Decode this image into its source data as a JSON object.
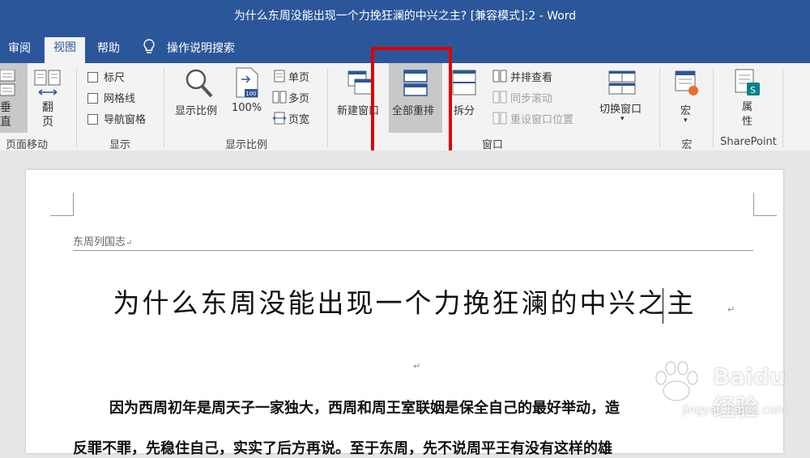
{
  "window": {
    "title": "为什么东周没能出现一个力挽狂澜的中兴之主?  [兼容模式]:2  -  Word"
  },
  "tabs": [
    {
      "label": "审阅"
    },
    {
      "label": "视图"
    },
    {
      "label": "帮助"
    },
    {
      "label": "操作说明搜索"
    }
  ],
  "ribbon": {
    "page_movement": {
      "vertical": "垂\n直",
      "flip": "翻\n页",
      "group": "页面移动"
    },
    "show": {
      "ruler": "标尺",
      "gridlines": "网格线",
      "nav_pane": "导航窗格",
      "group": "显示"
    },
    "zoom": {
      "zoom": "显示比例",
      "hundred": "100%",
      "one_page": "单页",
      "multi_page": "多页",
      "page_width": "页宽",
      "group": "显示比例"
    },
    "window": {
      "new_window": "新建窗口",
      "arrange_all": "全部重排",
      "split": "拆分",
      "side_by_side": "并排查看",
      "sync_scroll": "同步滚动",
      "reset_position": "重设窗口位置",
      "switch_windows": "切换窗口",
      "group": "窗口"
    },
    "macros": {
      "macros": "宏",
      "group": "宏"
    },
    "sharepoint": {
      "properties": "属\n性",
      "group": "SharePoint"
    }
  },
  "document": {
    "header": "东周列国志",
    "title": "为什么东周没能出现一个力挽狂澜的中兴之主",
    "para1": "因为西周初年是周天子一家独大，西周和周王室联姻是保全自己的最好举动，造",
    "para2": "反罪不罪，先稳住自己，实实了后方再说。至于东周，先不说周平王有没有这样的雄"
  },
  "watermark": {
    "text": "Baidu 经验",
    "url": "jingyan.baidu.com"
  },
  "colors": {
    "title_bar": "#2b579a",
    "ribbon": "#f3f3f3",
    "highlight": "#e10000"
  }
}
